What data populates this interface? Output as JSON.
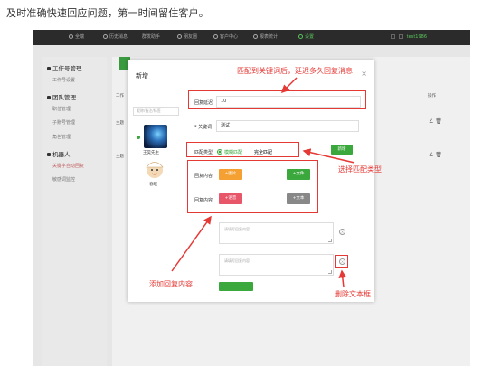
{
  "caption": "及时准确快速回应问题，第一时间留住客户。",
  "topbar": {
    "nav": [
      {
        "label": "全端",
        "icon": "home-icon"
      },
      {
        "label": "历史消息",
        "icon": "history-icon"
      },
      {
        "label": "群发助手",
        "icon": "broadcast-icon"
      },
      {
        "label": "朋友圈",
        "icon": "moments-icon"
      },
      {
        "label": "客户中心",
        "icon": "user-icon"
      },
      {
        "label": "报表统计",
        "icon": "chart-icon"
      },
      {
        "label": "设置",
        "icon": "settings-icon"
      }
    ],
    "user": "test1986"
  },
  "sidebar": {
    "groups": [
      {
        "title": "工作号管理",
        "items": [
          "工作号设置"
        ]
      },
      {
        "title": "团队管理",
        "items": [
          "职位管理",
          "子账号管理",
          "角色管理"
        ]
      },
      {
        "title": "机器人",
        "items": [
          "关键字自动回复",
          "敏感词监控"
        ]
      }
    ]
  },
  "main": {
    "header_left": "工作",
    "header_op": "操作",
    "rows": [
      "主题",
      "主题"
    ],
    "row_ops": "∠ 🗑"
  },
  "modal": {
    "title": "新增",
    "close": "×",
    "search_placeholder": "昵称/备注/标签",
    "contacts": [
      {
        "name": "王昊先生"
      },
      {
        "name": "春眠"
      }
    ],
    "delay_label": "回复延迟",
    "delay_value": "10",
    "keyword_label": "* 关键词",
    "keyword_value": "测试",
    "match_label": "匹配类型",
    "match_fuzzy": "模糊匹配",
    "match_exact": "完全匹配",
    "add_button": "新增",
    "reply_label": "回复内容",
    "buttons": {
      "image": "+图片",
      "file": "+文件",
      "voice": "+语音",
      "text": "+文本"
    },
    "textarea_placeholder": "请填写回复内容"
  },
  "annotations": {
    "delay": "匹配到关键词后，延迟多久回复消息",
    "match": "选择匹配类型",
    "add_content": "添加回复内容",
    "delete_text": "删除文本框"
  },
  "colors": {
    "accent": "#3aa83d",
    "annotation": "#e53935",
    "orange": "#f5a032",
    "pink": "#e8566a",
    "gray": "#888888"
  }
}
